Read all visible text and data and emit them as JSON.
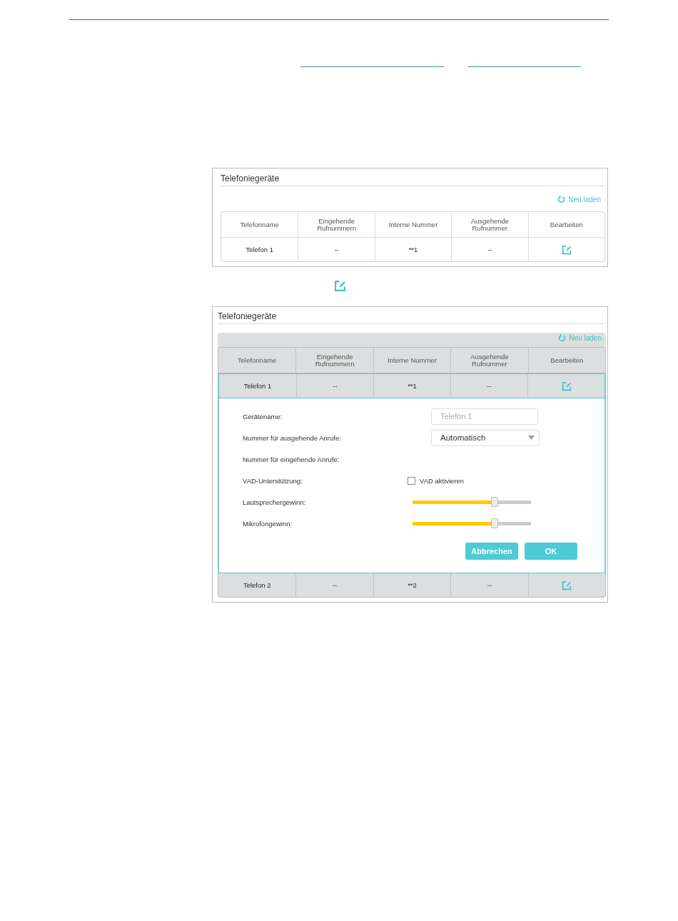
{
  "screenshots": [
    {
      "title": "Telefoniegeräte",
      "reload": "Neu laden",
      "edit_mode": false,
      "columns": [
        "Telefonname",
        "Eingehende Rufnummern",
        "Interne Nummer",
        "Ausgehende Rufnummer",
        "Bearbeiten"
      ],
      "rows": [
        {
          "cells": [
            "Telefon 1",
            "--",
            "**1",
            "--"
          ],
          "expanded": false
        }
      ]
    },
    {
      "title": "Telefoniegeräte",
      "reload": "Neu laden",
      "edit_mode": true,
      "columns": [
        "Telefonname",
        "Eingehende Rufnummern",
        "Interne Nummer",
        "Ausgehende Rufnummer",
        "Bearbeiten"
      ],
      "rows": [
        {
          "cells": [
            "Telefon 1",
            "--",
            "**1",
            "--"
          ],
          "expanded": true,
          "form": {
            "fields": [
              {
                "kind": "text",
                "label": "Gerätename:",
                "placeholder": "Telefon 1"
              },
              {
                "kind": "select",
                "label": "Nummer für ausgehende Anrufe:",
                "value": "Automatisch"
              },
              {
                "kind": "none",
                "label": "Nummer für eingehende Anrufe:"
              },
              {
                "kind": "checkbox",
                "label": "VAD-Unterstützung:",
                "option": "VAD aktivieren",
                "checked": false
              },
              {
                "kind": "slider",
                "label": "Lautsprechergewinn:",
                "level": 0.69
              },
              {
                "kind": "slider",
                "label": "Mikrofongewinn:",
                "level": 0.69
              }
            ],
            "buttons": [
              "Abbrechen",
              "OK"
            ]
          }
        },
        {
          "cells": [
            "Telefon 2",
            "--",
            "**2",
            "--"
          ],
          "expanded": false
        }
      ]
    }
  ]
}
